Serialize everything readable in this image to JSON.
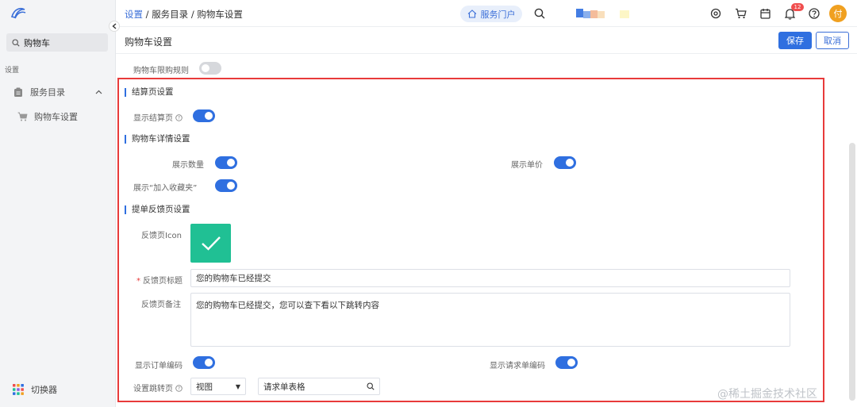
{
  "sidebar": {
    "search_value": "购物车",
    "section_label": "设置",
    "nav_group_label": "服务目录",
    "nav_sub_label": "购物车设置",
    "switcher_label": "切换器"
  },
  "topbar": {
    "breadcrumb": [
      "设置",
      "服务目录",
      "购物车设置"
    ],
    "separator": "/",
    "portal_label": "服务门户",
    "notification_count": "12",
    "avatar_text": "付"
  },
  "header": {
    "title": "购物车设置",
    "save_label": "保存",
    "cancel_label": "取消"
  },
  "form": {
    "limit_rule_label": "购物车限购规则",
    "limit_rule_on": false,
    "checkout_section": "结算页设置",
    "show_checkout_label": "显示结算页",
    "show_checkout_on": true,
    "detail_section": "购物车详情设置",
    "show_quantity_label": "展示数量",
    "show_quantity_on": true,
    "show_price_label": "展示单价",
    "show_price_on": true,
    "show_favorite_label": "展示“加入收藏夹”",
    "show_favorite_on": true,
    "feedback_section": "提单反馈页设置",
    "feedback_icon_label": "反馈页Icon",
    "feedback_title_label": "反馈页标题",
    "feedback_title_value": "您的购物车已经提交",
    "feedback_note_label": "反馈页备注",
    "feedback_note_value": "您的购物车已经提交，您可以查下看以下跳转内容",
    "show_order_code_label": "显示订单编码",
    "show_order_code_on": true,
    "show_request_code_label": "显示请求单编码",
    "show_request_code_on": true,
    "redirect_label": "设置跳转页",
    "redirect_select_value": "视图",
    "redirect_input_value": "请求单表格"
  },
  "watermark": "@稀土掘金技术社区",
  "colors": {
    "accent": "#2f6fe0",
    "icon_box": "#20c094",
    "frame": "#e83a3a"
  }
}
